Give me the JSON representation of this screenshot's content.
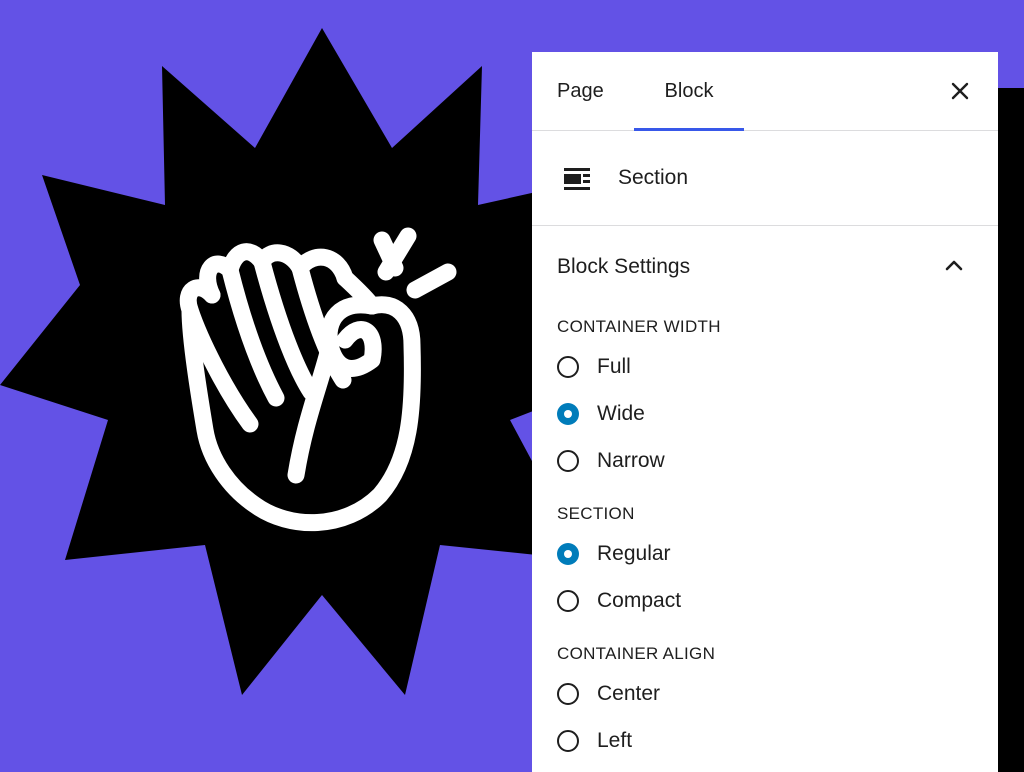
{
  "colors": {
    "background": "#6352e6",
    "burst": "#000000",
    "accent": "#007cba",
    "tab_indicator": "#3858e9"
  },
  "illustration": {
    "name": "burst-hand-illustration",
    "icons": [
      "star-burst-shape",
      "hand-icon"
    ]
  },
  "sidebar": {
    "tabs": [
      {
        "label": "Page",
        "active": false
      },
      {
        "label": "Block",
        "active": true
      }
    ],
    "close_icon": "close-icon",
    "block": {
      "icon": "section-block-icon",
      "name": "Section"
    },
    "panel": {
      "title": "Block Settings",
      "toggle_icon": "chevron-up-icon",
      "expanded": true,
      "groups": [
        {
          "label": "CONTAINER WIDTH",
          "options": [
            {
              "label": "Full",
              "checked": false
            },
            {
              "label": "Wide",
              "checked": true
            },
            {
              "label": "Narrow",
              "checked": false
            }
          ]
        },
        {
          "label": "SECTION",
          "options": [
            {
              "label": "Regular",
              "checked": true
            },
            {
              "label": "Compact",
              "checked": false
            }
          ]
        },
        {
          "label": "CONTAINER ALIGN",
          "options": [
            {
              "label": "Center",
              "checked": false
            },
            {
              "label": "Left",
              "checked": false
            }
          ]
        }
      ]
    }
  }
}
